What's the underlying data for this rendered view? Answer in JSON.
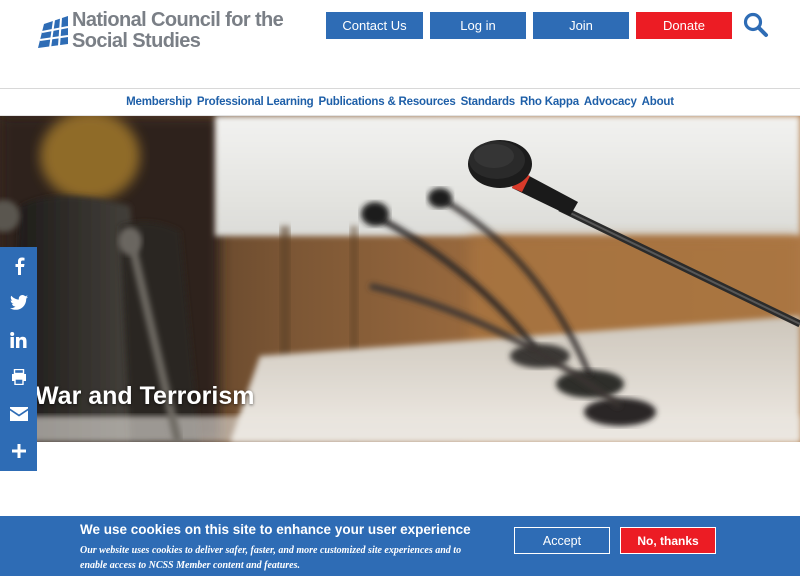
{
  "header": {
    "logo": {
      "line1": "National Council for the",
      "line2": "Social Studies",
      "icon": "globe-logo-icon",
      "text_color": "#7a7f86",
      "mark_color": "#2e6cb5"
    },
    "buttons": {
      "contact": "Contact Us",
      "login": "Log in",
      "join": "Join",
      "donate": "Donate"
    },
    "search_icon": "search-icon",
    "colors": {
      "primary": "#2e6cb5",
      "donate": "#ec1c24"
    }
  },
  "nav": {
    "items": [
      "Membership",
      "Professional Learning",
      "Publications & Resources",
      "Standards",
      "Rho Kappa",
      "Advocacy",
      "About"
    ],
    "color": "#1e5fa8"
  },
  "hero": {
    "title": "War and Terrorism",
    "image": "conference-microphones-photo"
  },
  "share": {
    "icons": [
      "facebook-icon",
      "twitter-icon",
      "linkedin-icon",
      "print-icon",
      "email-icon",
      "more-icon"
    ],
    "color": "#2e6cb5"
  },
  "cookie": {
    "title": "We use cookies on this site to enhance your user experience",
    "description": "Our website uses cookies to deliver safer, faster, and more customized site experiences and to enable access to NCSS Member content and features.",
    "accept": "Accept",
    "decline": "No, thanks"
  }
}
